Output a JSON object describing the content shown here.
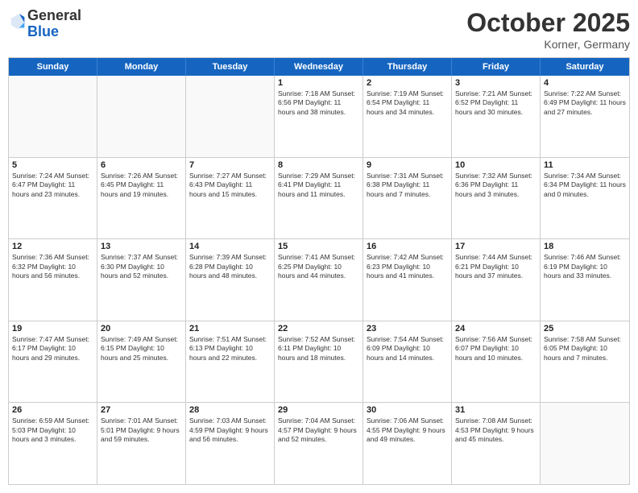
{
  "header": {
    "logo": {
      "general": "General",
      "blue": "Blue"
    },
    "month": "October 2025",
    "location": "Korner, Germany"
  },
  "days_of_week": [
    "Sunday",
    "Monday",
    "Tuesday",
    "Wednesday",
    "Thursday",
    "Friday",
    "Saturday"
  ],
  "weeks": [
    [
      {
        "day": "",
        "info": ""
      },
      {
        "day": "",
        "info": ""
      },
      {
        "day": "",
        "info": ""
      },
      {
        "day": "1",
        "info": "Sunrise: 7:18 AM\nSunset: 6:56 PM\nDaylight: 11 hours and 38 minutes."
      },
      {
        "day": "2",
        "info": "Sunrise: 7:19 AM\nSunset: 6:54 PM\nDaylight: 11 hours and 34 minutes."
      },
      {
        "day": "3",
        "info": "Sunrise: 7:21 AM\nSunset: 6:52 PM\nDaylight: 11 hours and 30 minutes."
      },
      {
        "day": "4",
        "info": "Sunrise: 7:22 AM\nSunset: 6:49 PM\nDaylight: 11 hours and 27 minutes."
      }
    ],
    [
      {
        "day": "5",
        "info": "Sunrise: 7:24 AM\nSunset: 6:47 PM\nDaylight: 11 hours and 23 minutes."
      },
      {
        "day": "6",
        "info": "Sunrise: 7:26 AM\nSunset: 6:45 PM\nDaylight: 11 hours and 19 minutes."
      },
      {
        "day": "7",
        "info": "Sunrise: 7:27 AM\nSunset: 6:43 PM\nDaylight: 11 hours and 15 minutes."
      },
      {
        "day": "8",
        "info": "Sunrise: 7:29 AM\nSunset: 6:41 PM\nDaylight: 11 hours and 11 minutes."
      },
      {
        "day": "9",
        "info": "Sunrise: 7:31 AM\nSunset: 6:38 PM\nDaylight: 11 hours and 7 minutes."
      },
      {
        "day": "10",
        "info": "Sunrise: 7:32 AM\nSunset: 6:36 PM\nDaylight: 11 hours and 3 minutes."
      },
      {
        "day": "11",
        "info": "Sunrise: 7:34 AM\nSunset: 6:34 PM\nDaylight: 11 hours and 0 minutes."
      }
    ],
    [
      {
        "day": "12",
        "info": "Sunrise: 7:36 AM\nSunset: 6:32 PM\nDaylight: 10 hours and 56 minutes."
      },
      {
        "day": "13",
        "info": "Sunrise: 7:37 AM\nSunset: 6:30 PM\nDaylight: 10 hours and 52 minutes."
      },
      {
        "day": "14",
        "info": "Sunrise: 7:39 AM\nSunset: 6:28 PM\nDaylight: 10 hours and 48 minutes."
      },
      {
        "day": "15",
        "info": "Sunrise: 7:41 AM\nSunset: 6:25 PM\nDaylight: 10 hours and 44 minutes."
      },
      {
        "day": "16",
        "info": "Sunrise: 7:42 AM\nSunset: 6:23 PM\nDaylight: 10 hours and 41 minutes."
      },
      {
        "day": "17",
        "info": "Sunrise: 7:44 AM\nSunset: 6:21 PM\nDaylight: 10 hours and 37 minutes."
      },
      {
        "day": "18",
        "info": "Sunrise: 7:46 AM\nSunset: 6:19 PM\nDaylight: 10 hours and 33 minutes."
      }
    ],
    [
      {
        "day": "19",
        "info": "Sunrise: 7:47 AM\nSunset: 6:17 PM\nDaylight: 10 hours and 29 minutes."
      },
      {
        "day": "20",
        "info": "Sunrise: 7:49 AM\nSunset: 6:15 PM\nDaylight: 10 hours and 25 minutes."
      },
      {
        "day": "21",
        "info": "Sunrise: 7:51 AM\nSunset: 6:13 PM\nDaylight: 10 hours and 22 minutes."
      },
      {
        "day": "22",
        "info": "Sunrise: 7:52 AM\nSunset: 6:11 PM\nDaylight: 10 hours and 18 minutes."
      },
      {
        "day": "23",
        "info": "Sunrise: 7:54 AM\nSunset: 6:09 PM\nDaylight: 10 hours and 14 minutes."
      },
      {
        "day": "24",
        "info": "Sunrise: 7:56 AM\nSunset: 6:07 PM\nDaylight: 10 hours and 10 minutes."
      },
      {
        "day": "25",
        "info": "Sunrise: 7:58 AM\nSunset: 6:05 PM\nDaylight: 10 hours and 7 minutes."
      }
    ],
    [
      {
        "day": "26",
        "info": "Sunrise: 6:59 AM\nSunset: 5:03 PM\nDaylight: 10 hours and 3 minutes."
      },
      {
        "day": "27",
        "info": "Sunrise: 7:01 AM\nSunset: 5:01 PM\nDaylight: 9 hours and 59 minutes."
      },
      {
        "day": "28",
        "info": "Sunrise: 7:03 AM\nSunset: 4:59 PM\nDaylight: 9 hours and 56 minutes."
      },
      {
        "day": "29",
        "info": "Sunrise: 7:04 AM\nSunset: 4:57 PM\nDaylight: 9 hours and 52 minutes."
      },
      {
        "day": "30",
        "info": "Sunrise: 7:06 AM\nSunset: 4:55 PM\nDaylight: 9 hours and 49 minutes."
      },
      {
        "day": "31",
        "info": "Sunrise: 7:08 AM\nSunset: 4:53 PM\nDaylight: 9 hours and 45 minutes."
      },
      {
        "day": "",
        "info": ""
      }
    ]
  ]
}
